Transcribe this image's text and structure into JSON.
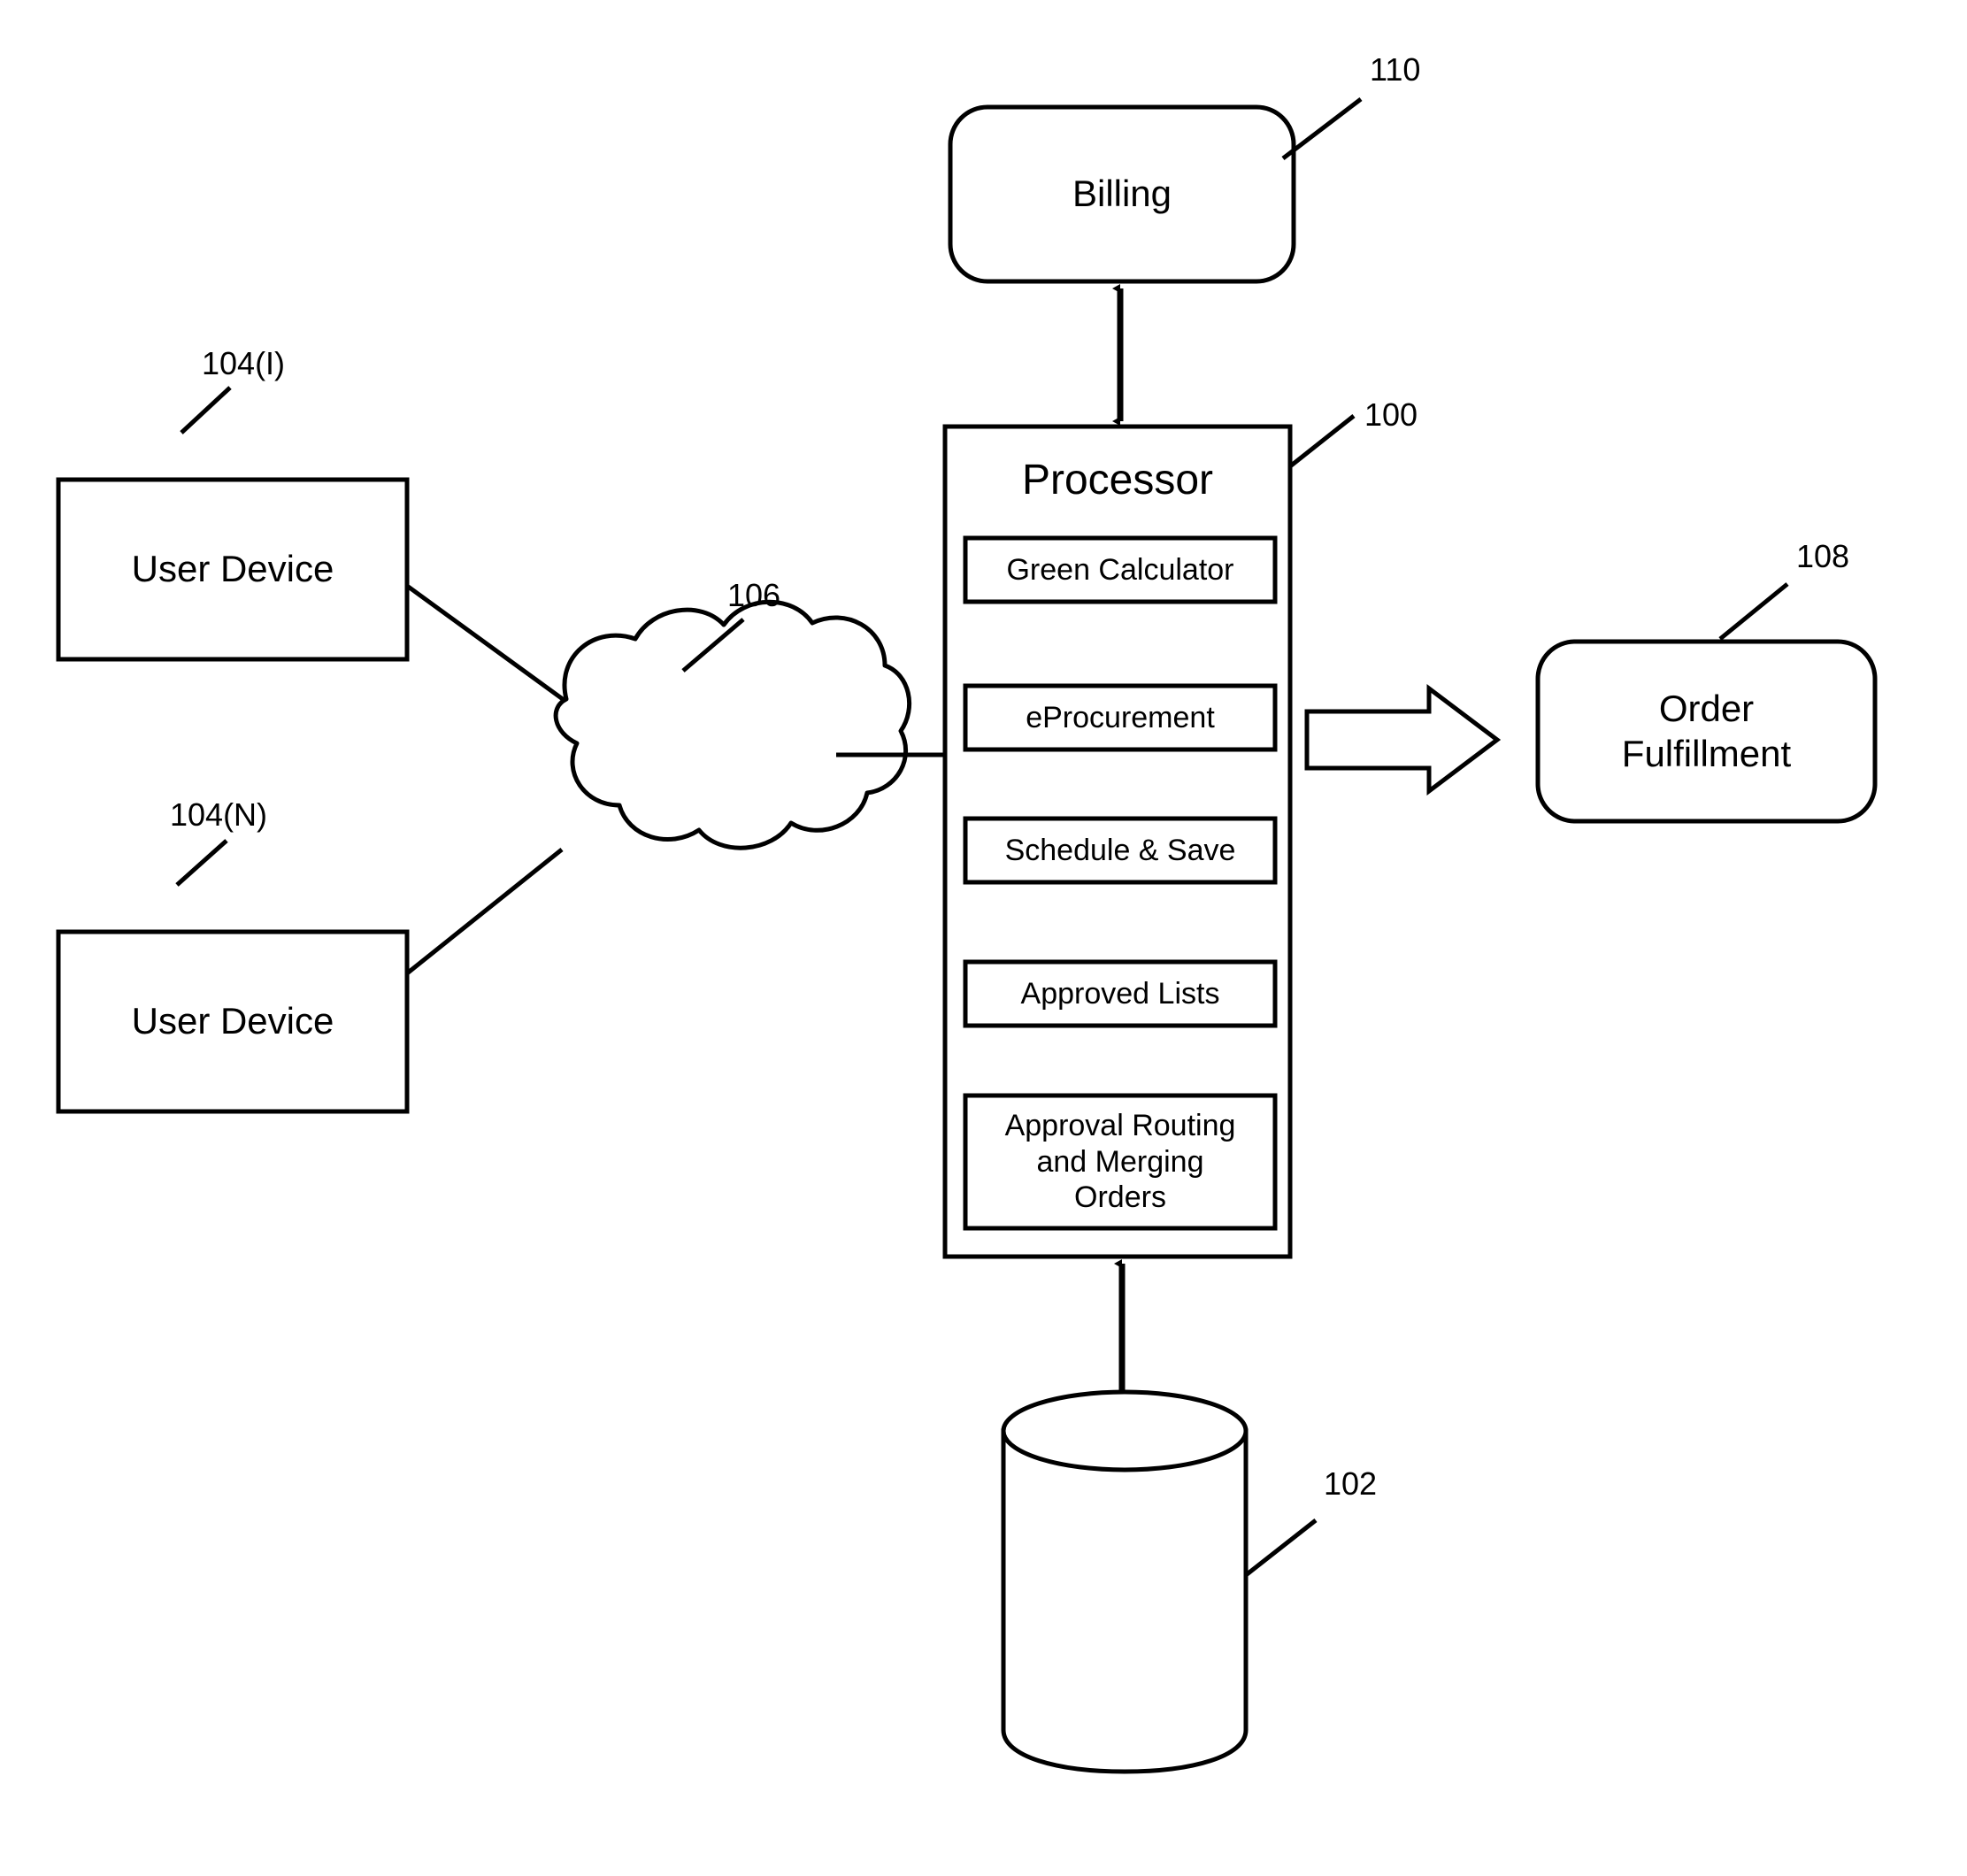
{
  "diagram": {
    "nodes": {
      "user_device_1": {
        "label": "User Device",
        "ref": "104(I)"
      },
      "user_device_n": {
        "label": "User Device",
        "ref": "104(N)"
      },
      "network_cloud": {
        "label": "",
        "ref": "106"
      },
      "billing": {
        "label": "Billing",
        "ref": "110"
      },
      "processor": {
        "label": "Processor",
        "ref": "100"
      },
      "order_fulfillment": {
        "label": "Order\nFulfillment",
        "ref": "108"
      },
      "database": {
        "label": "",
        "ref": "102"
      }
    },
    "processor_modules": [
      {
        "label": "Green Calculator"
      },
      {
        "label": "eProcurement"
      },
      {
        "label": "Schedule & Save"
      },
      {
        "label": "Approved Lists"
      },
      {
        "label": "Approval Routing\nand Merging\nOrders"
      }
    ],
    "colors": {
      "stroke": "#000000",
      "background": "#ffffff"
    }
  }
}
